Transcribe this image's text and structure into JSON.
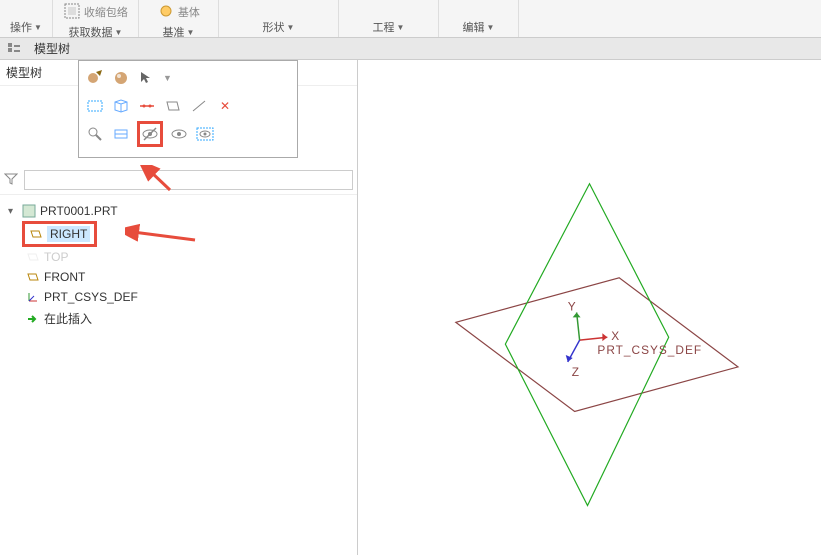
{
  "ribbon": {
    "operate_label": "操作",
    "get_data_label": "获取数据",
    "datum_label": "基准",
    "shape_label": "形状",
    "eng_label": "工程",
    "edit_label": "编辑",
    "shrink_label": "收缩包络",
    "base_label": "基体"
  },
  "tabs": {
    "model_tree_label": "模型树",
    "model_tree_label2": "模型树"
  },
  "tree": {
    "root": "PRT0001.PRT",
    "items": [
      {
        "label": "RIGHT",
        "type": "plane",
        "selected": true,
        "highlighted": true
      },
      {
        "label": "TOP",
        "type": "plane",
        "dimmed": true
      },
      {
        "label": "FRONT",
        "type": "plane"
      },
      {
        "label": "PRT_CSYS_DEF",
        "type": "csys"
      },
      {
        "label": "在此插入",
        "type": "insert"
      }
    ]
  },
  "viewport": {
    "csys_label": "PRT_CSYS_DEF",
    "axis_x": "X",
    "axis_y": "Y",
    "axis_z": "Z"
  }
}
